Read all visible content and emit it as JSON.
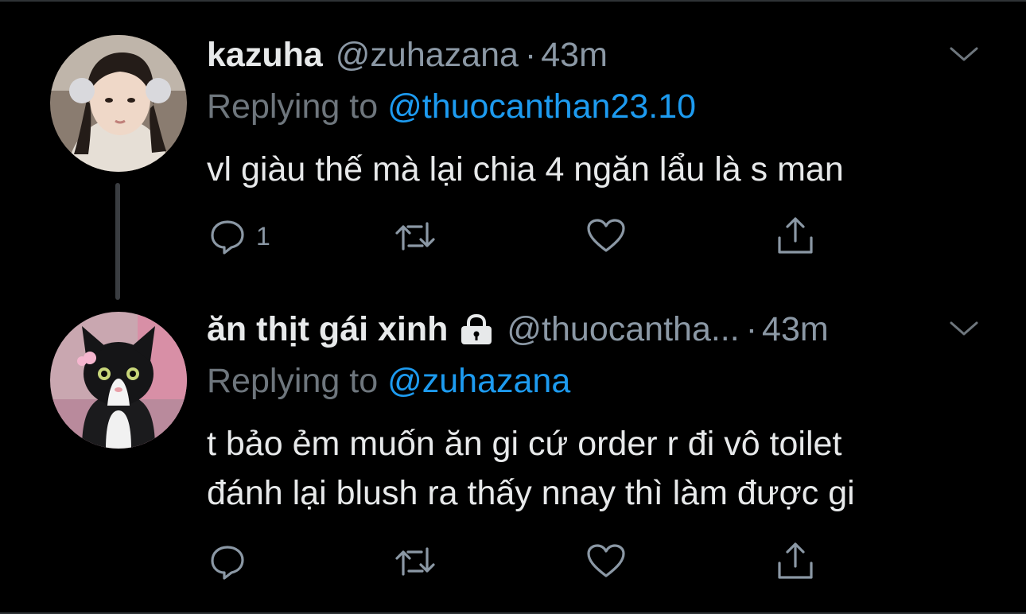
{
  "colors": {
    "background": "#000000",
    "text": "#e7e9ea",
    "secondary_text": "#8b98a5",
    "link": "#1d9bf0",
    "thread_line": "#3a3d41"
  },
  "tweets": [
    {
      "display_name": "kazuha",
      "handle": "@zuhazana",
      "separator": "·",
      "time": "43m",
      "replying_label": "Replying to",
      "replying_to": "@thuocanthan23.10",
      "text_lines": [
        "vl giàu thế mà lại chia 4 ngăn lẩu là s man"
      ],
      "reply_count": "1",
      "avatar_icon": "avatar-photo-person",
      "locked": false
    },
    {
      "display_name": "ăn thịt gái xinh",
      "handle": "@thuocantha...",
      "separator": "·",
      "time": "43m",
      "replying_label": "Replying to",
      "replying_to": "@zuhazana",
      "text_lines": [
        "t bảo ẻm muốn ăn gi cứ order r đi vô toilet",
        "đánh lại blush ra thấy nnay thì làm được gi"
      ],
      "reply_count": "",
      "avatar_icon": "avatar-photo-cat",
      "locked": true
    }
  ],
  "icons": {
    "reply": "reply-icon",
    "retweet": "retweet-icon",
    "like": "heart-icon",
    "share": "share-icon",
    "more": "chevron-down-icon",
    "lock": "lock-icon"
  }
}
